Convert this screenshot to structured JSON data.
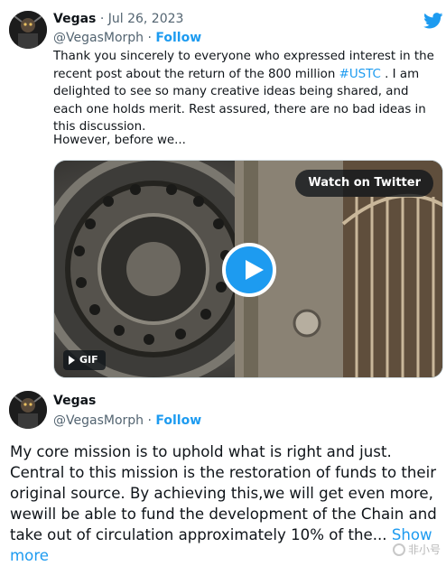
{
  "tweet1": {
    "name": "Vegas",
    "separator": "·",
    "date": "Jul 26, 2023",
    "handle": "@VegasMorph",
    "handle_separator": " · ",
    "follow_label": "Follow",
    "text_before_hashtag": "Thank you sincerely to everyone who expressed interest in the recent post about the return of the 800 million ",
    "hashtag": "#USTC",
    "text_after_hashtag": " . I am delighted to see so many creative ideas being shared, and each one holds merit. Rest assured, there are no bad ideas in this discussion.",
    "truncated_line": "However, before we...",
    "media": {
      "watch_label": "Watch on Twitter",
      "gif_label": "GIF"
    },
    "icon": "twitter-bird-icon",
    "accent_color": "#1d9bf0"
  },
  "tweet2": {
    "name": "Vegas",
    "handle": "@VegasMorph",
    "handle_separator": " · ",
    "follow_label": "Follow",
    "text": "My core mission is to uphold what is right and just. Central to this mission is the restoration of funds to their original source. By achieving this,we will get even more, wewill be  able to fund the development of the Chain and take out of circulation  approximately 10% of the...",
    "show_more_label": "Show more"
  },
  "watermark": {
    "text": "非小号"
  }
}
